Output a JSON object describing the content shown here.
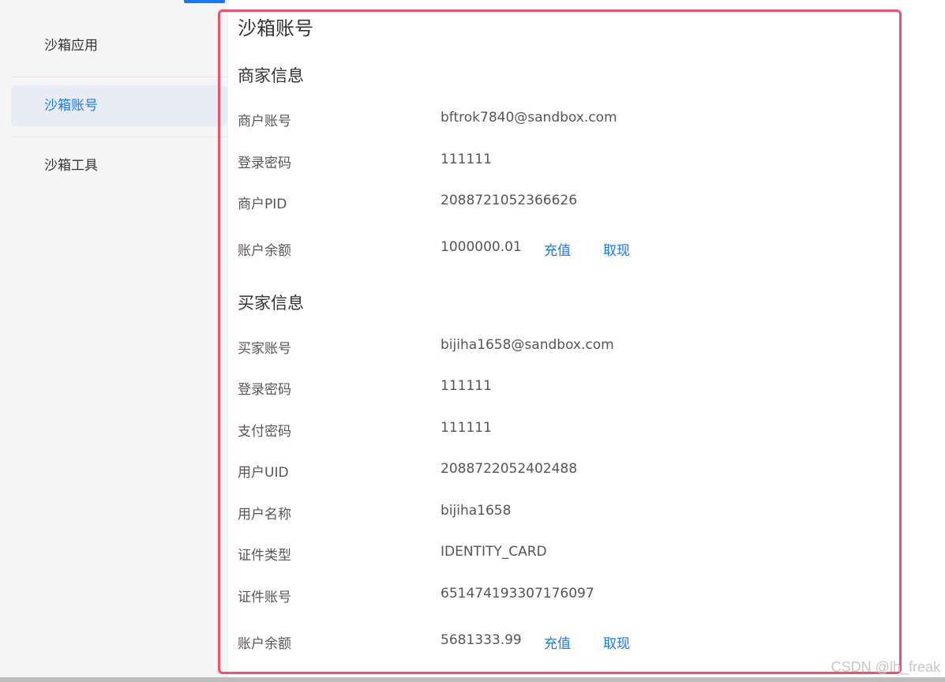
{
  "sidebar": {
    "items": [
      {
        "label": "沙箱应用"
      },
      {
        "label": "沙箱账号"
      },
      {
        "label": "沙箱工具"
      }
    ]
  },
  "main": {
    "title": "沙箱账号",
    "merchant": {
      "title": "商家信息",
      "rows": [
        {
          "label": "商户账号",
          "value": "bftrok7840@sandbox.com"
        },
        {
          "label": "登录密码",
          "value": "111111"
        },
        {
          "label": "商户PID",
          "value": "2088721052366626"
        },
        {
          "label": "账户余额",
          "value": "1000000.01"
        }
      ],
      "actions": {
        "recharge": "充值",
        "withdraw": "取现"
      }
    },
    "buyer": {
      "title": "买家信息",
      "rows": [
        {
          "label": "买家账号",
          "value": "bijiha1658@sandbox.com"
        },
        {
          "label": "登录密码",
          "value": "111111"
        },
        {
          "label": "支付密码",
          "value": "111111"
        },
        {
          "label": "用户UID",
          "value": "2088722052402488"
        },
        {
          "label": "用户名称",
          "value": "bijiha1658"
        },
        {
          "label": "证件类型",
          "value": "IDENTITY_CARD"
        },
        {
          "label": "证件账号",
          "value": "651474193307176097"
        },
        {
          "label": "账户余额",
          "value": "5681333.99"
        }
      ],
      "actions": {
        "recharge": "充值",
        "withdraw": "取现"
      }
    }
  },
  "watermark": "CSDN @lh_freak",
  "colors": {
    "accent": "#1677ff",
    "highlight": "#f0506e"
  }
}
